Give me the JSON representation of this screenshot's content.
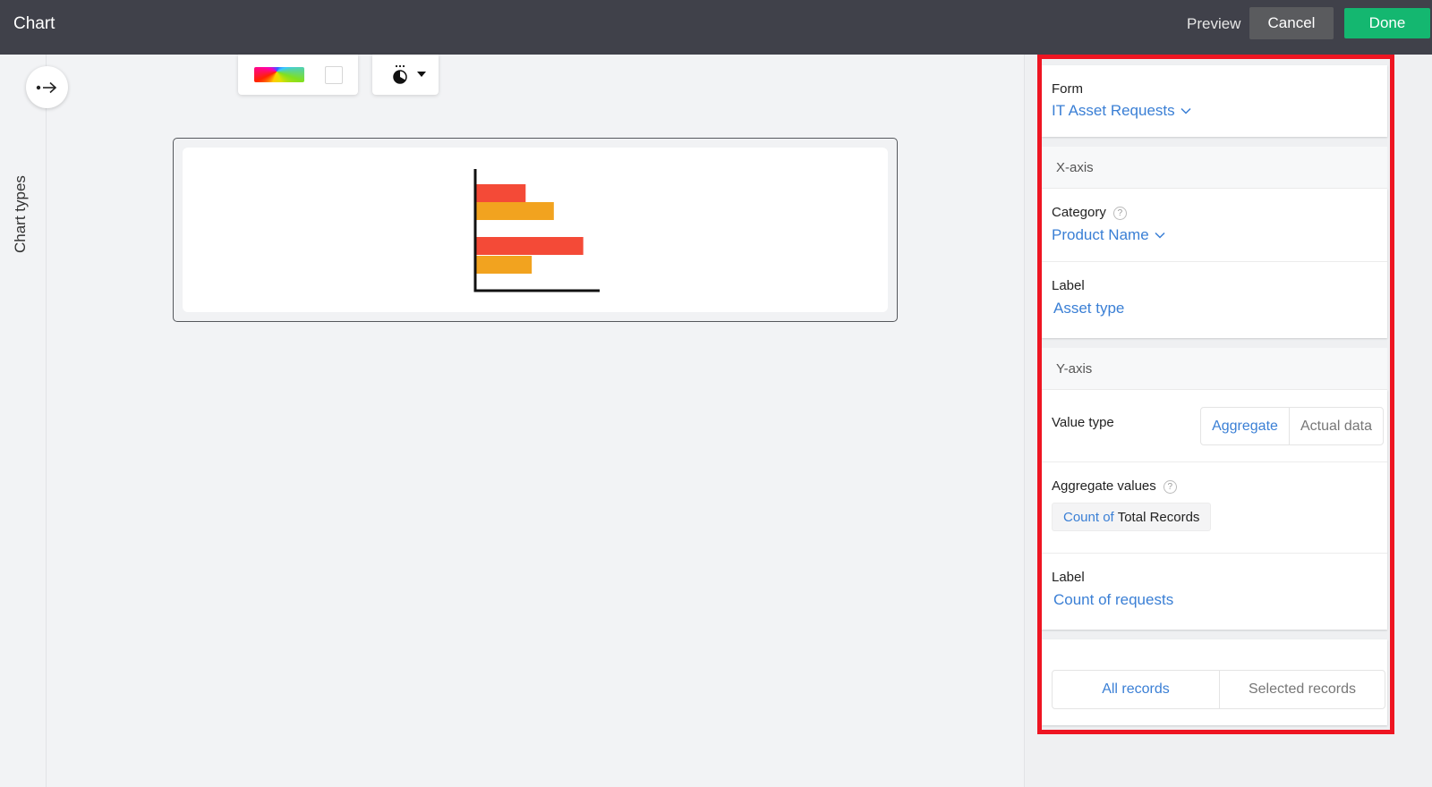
{
  "header": {
    "title": "Chart",
    "preview_label": "Preview",
    "cancel_label": "Cancel",
    "done_label": "Done"
  },
  "left_rail": {
    "expand_icon": "dot-arrow-right-icon",
    "label": "Chart types"
  },
  "toolbar": {
    "palette_icon": "color-palette-icon",
    "background_icon": "background-color-icon",
    "theme_icon": "theme-contrast-icon",
    "theme_dropdown_icon": "caret-down-icon"
  },
  "preview_chart": {
    "type": "horizontal-bar-icon",
    "colors": {
      "series_a": "#f44a37",
      "series_b": "#f2a31f",
      "axis": "#111111"
    },
    "relative_lengths": [
      {
        "series": "a",
        "value": 0.4
      },
      {
        "series": "b",
        "value": 0.63
      },
      {
        "series": "a",
        "value": 0.87
      },
      {
        "series": "b",
        "value": 0.45
      }
    ]
  },
  "config_panel": {
    "form": {
      "label": "Form",
      "value": "IT Asset Requests"
    },
    "x_axis": {
      "heading": "X-axis",
      "category_label": "Category",
      "category_value": "Product Name",
      "label_label": "Label",
      "label_value": "Asset type"
    },
    "y_axis": {
      "heading": "Y-axis",
      "value_type_label": "Value type",
      "value_type_options": [
        "Aggregate",
        "Actual data"
      ],
      "value_type_selected": "Aggregate",
      "aggregate_label": "Aggregate values",
      "aggregate_prefix": "Count of",
      "aggregate_field": "Total Records",
      "label_label": "Label",
      "label_value": "Count of requests"
    },
    "records": {
      "options": [
        "All records",
        "Selected records"
      ],
      "selected": "All records"
    }
  },
  "colors": {
    "header_bg": "#40414a",
    "done_green": "#14b770",
    "cancel_gray": "#5a5b5e",
    "link_blue": "#3a7fd5",
    "highlight_red": "#ee1522"
  }
}
